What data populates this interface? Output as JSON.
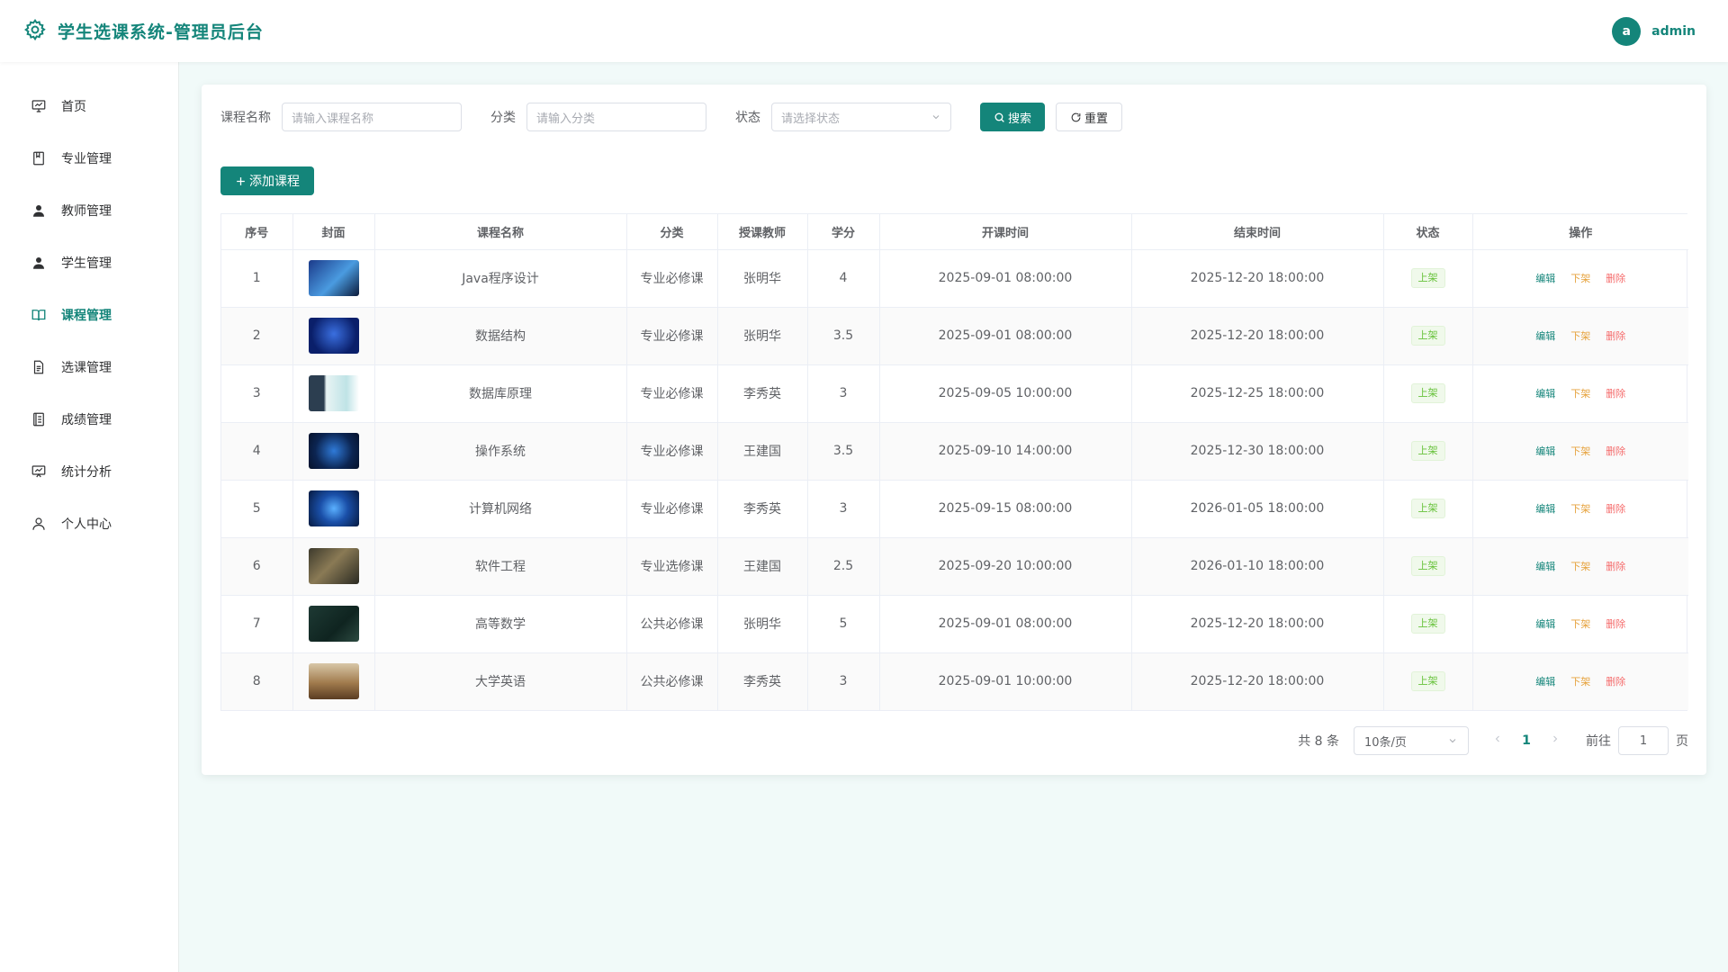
{
  "header": {
    "title": "学生选课系统-管理员后台",
    "avatar_letter": "a",
    "username": "admin"
  },
  "sidebar": {
    "items": [
      {
        "label": "首页",
        "icon": "dashboard-icon"
      },
      {
        "label": "专业管理",
        "icon": "book-icon"
      },
      {
        "label": "教师管理",
        "icon": "user-icon"
      },
      {
        "label": "学生管理",
        "icon": "user-icon"
      },
      {
        "label": "课程管理",
        "icon": "open-book-icon",
        "active": true
      },
      {
        "label": "选课管理",
        "icon": "document-icon"
      },
      {
        "label": "成绩管理",
        "icon": "notebook-icon"
      },
      {
        "label": "统计分析",
        "icon": "chart-icon"
      },
      {
        "label": "个人中心",
        "icon": "person-icon"
      }
    ]
  },
  "filters": {
    "course_name_label": "课程名称",
    "course_name_placeholder": "请输入课程名称",
    "category_label": "分类",
    "category_placeholder": "请输入分类",
    "status_label": "状态",
    "status_placeholder": "请选择状态",
    "search_label": "搜索",
    "reset_label": "重置"
  },
  "add_button_label": "添加课程",
  "table": {
    "columns": [
      "序号",
      "封面",
      "课程名称",
      "分类",
      "授课教师",
      "学分",
      "开课时间",
      "结束时间",
      "状态",
      "操作"
    ],
    "rows": [
      {
        "no": "1",
        "name": "Java程序设计",
        "category": "专业必修课",
        "teacher": "张明华",
        "credit": "4",
        "start": "2025-09-01 08:00:00",
        "end": "2025-12-20 18:00:00",
        "status": "上架"
      },
      {
        "no": "2",
        "name": "数据结构",
        "category": "专业必修课",
        "teacher": "张明华",
        "credit": "3.5",
        "start": "2025-09-01 08:00:00",
        "end": "2025-12-20 18:00:00",
        "status": "上架"
      },
      {
        "no": "3",
        "name": "数据库原理",
        "category": "专业必修课",
        "teacher": "李秀英",
        "credit": "3",
        "start": "2025-09-05 10:00:00",
        "end": "2025-12-25 18:00:00",
        "status": "上架"
      },
      {
        "no": "4",
        "name": "操作系统",
        "category": "专业必修课",
        "teacher": "王建国",
        "credit": "3.5",
        "start": "2025-09-10 14:00:00",
        "end": "2025-12-30 18:00:00",
        "status": "上架"
      },
      {
        "no": "5",
        "name": "计算机网络",
        "category": "专业必修课",
        "teacher": "李秀英",
        "credit": "3",
        "start": "2025-09-15 08:00:00",
        "end": "2026-01-05 18:00:00",
        "status": "上架"
      },
      {
        "no": "6",
        "name": "软件工程",
        "category": "专业选修课",
        "teacher": "王建国",
        "credit": "2.5",
        "start": "2025-09-20 10:00:00",
        "end": "2026-01-10 18:00:00",
        "status": "上架"
      },
      {
        "no": "7",
        "name": "高等数学",
        "category": "公共必修课",
        "teacher": "张明华",
        "credit": "5",
        "start": "2025-09-01 08:00:00",
        "end": "2025-12-20 18:00:00",
        "status": "上架"
      },
      {
        "no": "8",
        "name": "大学英语",
        "category": "公共必修课",
        "teacher": "李秀英",
        "credit": "3",
        "start": "2025-09-01 10:00:00",
        "end": "2025-12-20 18:00:00",
        "status": "上架"
      }
    ],
    "ops": {
      "edit": "编辑",
      "off_shelf": "下架",
      "delete": "删除"
    }
  },
  "pagination": {
    "total_text": "共 8 条",
    "page_size": "10条/页",
    "current_page": "1",
    "goto_label": "前往",
    "goto_value": "1",
    "page_suffix": "页"
  },
  "colors": {
    "accent": "#14857a",
    "background": "#f1faf9",
    "tag_green": "#67c23a",
    "warning": "#e6a23c",
    "danger": "#f56c6c"
  }
}
